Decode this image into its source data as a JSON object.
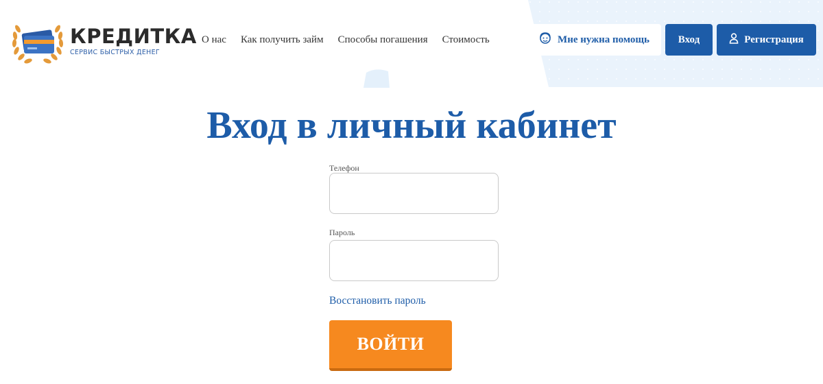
{
  "brand": {
    "name": "КРЕДИТКА",
    "tagline": "СЕРВИС БЫСТРЫХ ДЕНЕГ",
    "emblem_icon": "credit-card-laurel-icon"
  },
  "nav": {
    "items": [
      {
        "label": "О нас"
      },
      {
        "label": "Как получить займ"
      },
      {
        "label": "Способы погашения"
      },
      {
        "label": "Стоимость"
      }
    ]
  },
  "header_actions": {
    "help_label": "Мне нужна помощь",
    "help_icon": "support-face-icon",
    "login_label": "Вход",
    "register_label": "Регистрация",
    "register_icon": "user-icon"
  },
  "login_form": {
    "title": "Вход в личный кабинет",
    "phone_label": "Телефон",
    "phone_value": "",
    "password_label": "Пароль",
    "password_value": "",
    "restore_link": "Восстановить пароль",
    "submit_label": "ВОЙТИ"
  },
  "colors": {
    "primary": "#1d5ca8",
    "accent_orange": "#f6891f",
    "background_light_blue": "#eaf3fc"
  }
}
